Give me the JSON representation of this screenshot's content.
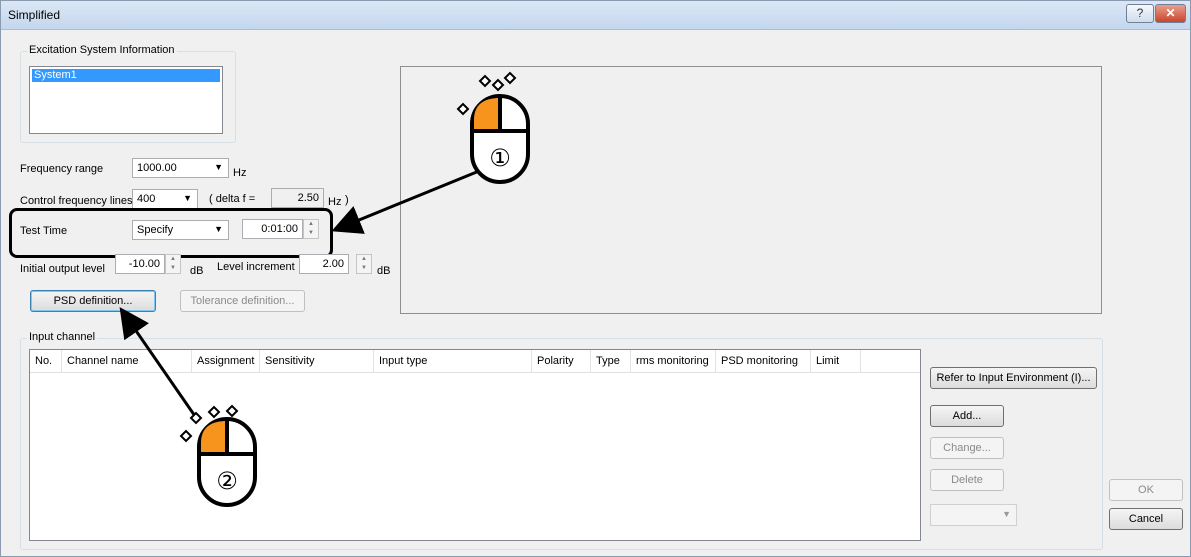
{
  "window": {
    "title": "Simplified",
    "help_label": "?",
    "close_label": "✕"
  },
  "excitation": {
    "legend": "Excitation System Information",
    "items": [
      "System1"
    ]
  },
  "frequency_range": {
    "label": "Frequency range",
    "value": "1000.00",
    "unit": "Hz"
  },
  "control_lines": {
    "label": "Control frequency lines",
    "value": "400",
    "delta_prefix": "( delta f =",
    "delta_value": "2.50",
    "delta_unit": "Hz",
    "delta_suffix": ")"
  },
  "test_time": {
    "label": "Test Time",
    "mode": "Specify",
    "value": "0:01:00"
  },
  "output": {
    "initial_label": "Initial output level",
    "initial_value": "-10.00",
    "initial_unit": "dB",
    "increment_label": "Level increment",
    "increment_value": "2.00",
    "increment_unit": "dB"
  },
  "buttons": {
    "psd": "PSD definition...",
    "tolerance": "Tolerance definition...",
    "refer": "Refer to Input Environment (I)...",
    "add": "Add...",
    "change": "Change...",
    "delete": "Delete",
    "ok": "OK",
    "cancel": "Cancel"
  },
  "input_channel": {
    "legend": "Input channel",
    "columns": [
      "No.",
      "Channel name",
      "Assignment",
      "Sensitivity",
      "Input type",
      "Polarity",
      "Type",
      "rms monitoring",
      "PSD monitoring",
      "Limit"
    ]
  },
  "annotations": {
    "step1": "①",
    "step2": "②"
  },
  "colors": {
    "accent": "#f7941d",
    "selection": "#3399ff"
  },
  "icons": [
    "mouse-left-click-icon",
    "help-icon",
    "close-icon",
    "chevron-down-icon",
    "spin-up-icon",
    "spin-down-icon"
  ]
}
